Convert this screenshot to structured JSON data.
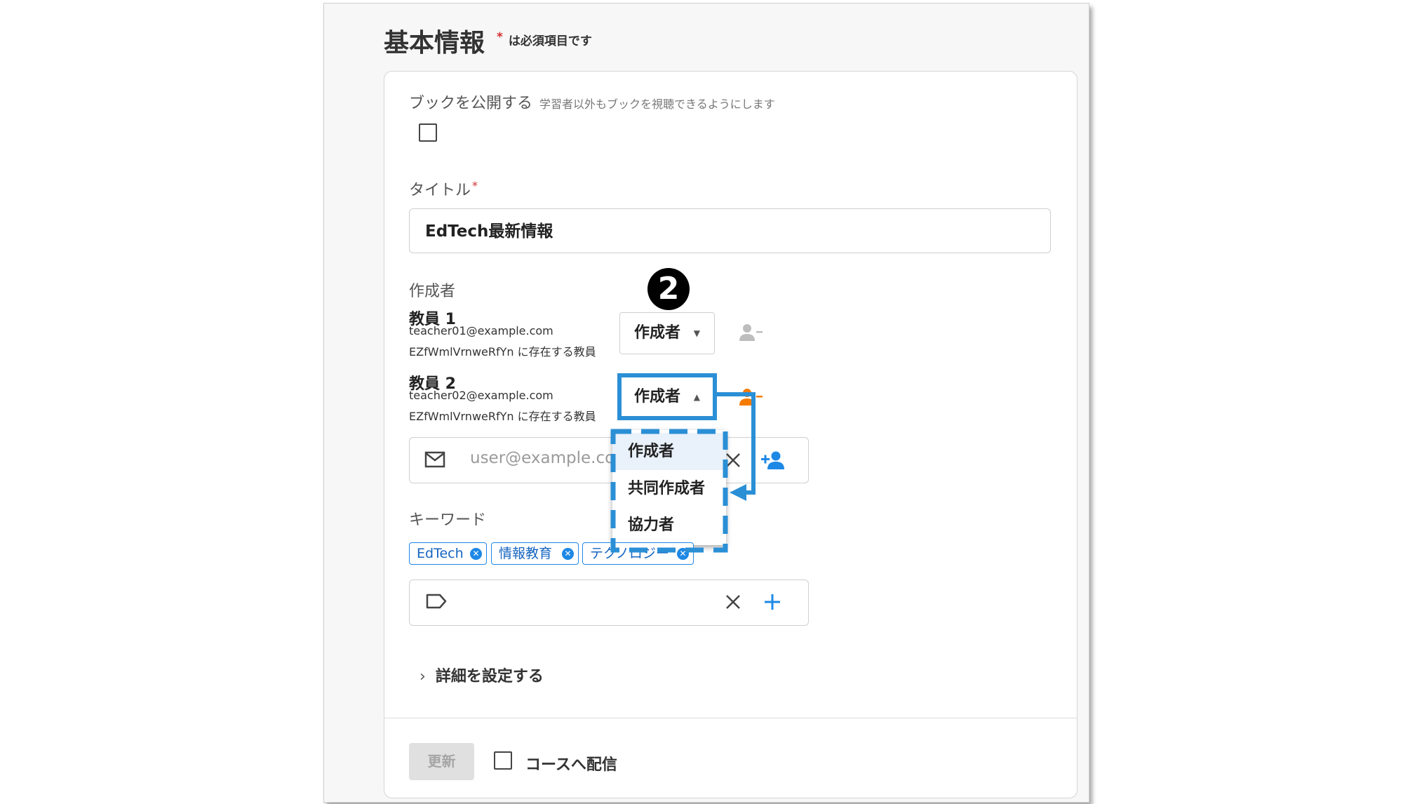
{
  "header": {
    "title": "基本情報",
    "required_star": "*",
    "required_note": "は必須項目です"
  },
  "publish": {
    "label": "ブックを公開する",
    "hint": "学習者以外もブックを視聴できるようにします",
    "checked": false
  },
  "title_field": {
    "label": "タイトル",
    "required_star": "*",
    "value": "EdTech最新情報"
  },
  "authors": {
    "label": "作成者",
    "members": [
      {
        "name": "教員 1",
        "email": "teacher01@example.com",
        "org": "EZfWmlVrnweRfYn に存在する教員",
        "role": "作成者"
      },
      {
        "name": "教員 2",
        "email": "teacher02@example.com",
        "org": "EZfWmlVrnweRfYn に存在する教員",
        "role": "作成者"
      }
    ],
    "email_placeholder": "user@example.com",
    "annotation_number": "2"
  },
  "role_menu": {
    "options": [
      "作成者",
      "共同作成者",
      "協力者"
    ],
    "selected": "作成者"
  },
  "keywords": {
    "label": "キーワード",
    "chips": [
      "EdTech",
      "情報教育",
      "テクノロジー"
    ]
  },
  "details": {
    "label": "詳細を設定する"
  },
  "footer": {
    "update_label": "更新",
    "course_label": "コースへ配信",
    "course_checked": false
  },
  "colors": {
    "accent": "#1e88e5",
    "annotation": "#2b8fd6",
    "required": "#d32f2f",
    "remove_active": "#f57c00"
  }
}
